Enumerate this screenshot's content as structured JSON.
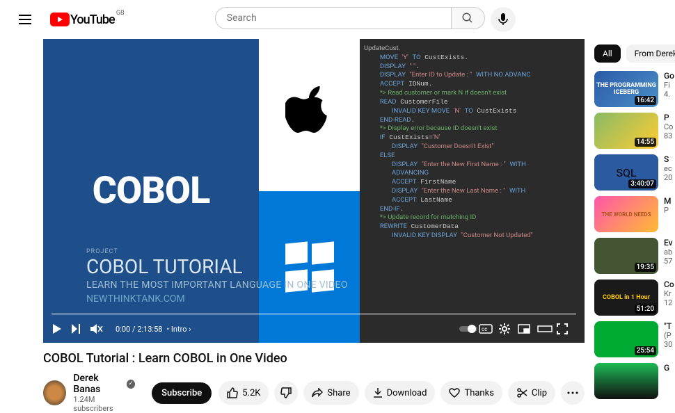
{
  "header": {
    "logo_text": "YouTube",
    "region": "GB",
    "search_placeholder": "Search"
  },
  "player": {
    "thumb_big": "COBOL",
    "proj": "PROJECT",
    "overlay_title": "COBOL TUTORIAL",
    "overlay_sub": "LEARN THE MOST IMPORTANT LANGUAGE IN ONE VIDEO",
    "overlay_url": "NEWTHINKTANK.COM",
    "time": "0:00 / 2:13:58",
    "chapter": "Intro"
  },
  "video": {
    "title": "COBOL Tutorial : Learn COBOL in One Video",
    "channel": "Derek Banas",
    "subs": "1.24M subscribers",
    "subscribe": "Subscribe",
    "likes": "5.2K",
    "share": "Share",
    "download": "Download",
    "thanks": "Thanks",
    "clip": "Clip"
  },
  "filters": {
    "all": "All",
    "from": "From Derek Banas"
  },
  "recs": [
    {
      "title": "Go",
      "ch": "Fi",
      "views": "4.",
      "dur": "16:42",
      "thumb": "THE PROGRAMMING ICEBERG"
    },
    {
      "title": "P",
      "ch": "Co",
      "views": "83",
      "dur": "14:55"
    },
    {
      "title": "S",
      "ch": "ec",
      "views": "20",
      "dur": "3:40:07",
      "thumb": "SQL"
    },
    {
      "title": "M",
      "ch": "P",
      "views": "",
      "dur": "",
      "thumb": "THE WORLD NEEDS"
    },
    {
      "title": "Ev",
      "ch": "ab",
      "views": "57",
      "dur": "19:35"
    },
    {
      "title": "Co",
      "ch": "Kr",
      "views": "12",
      "dur": "51:20",
      "thumb": "COBOL in 1 Hour"
    },
    {
      "title": "\"T",
      "ch": "(P",
      "views": "30",
      "dur": "25:54"
    },
    {
      "title": "G",
      "ch": "",
      "views": "",
      "dur": ""
    }
  ]
}
